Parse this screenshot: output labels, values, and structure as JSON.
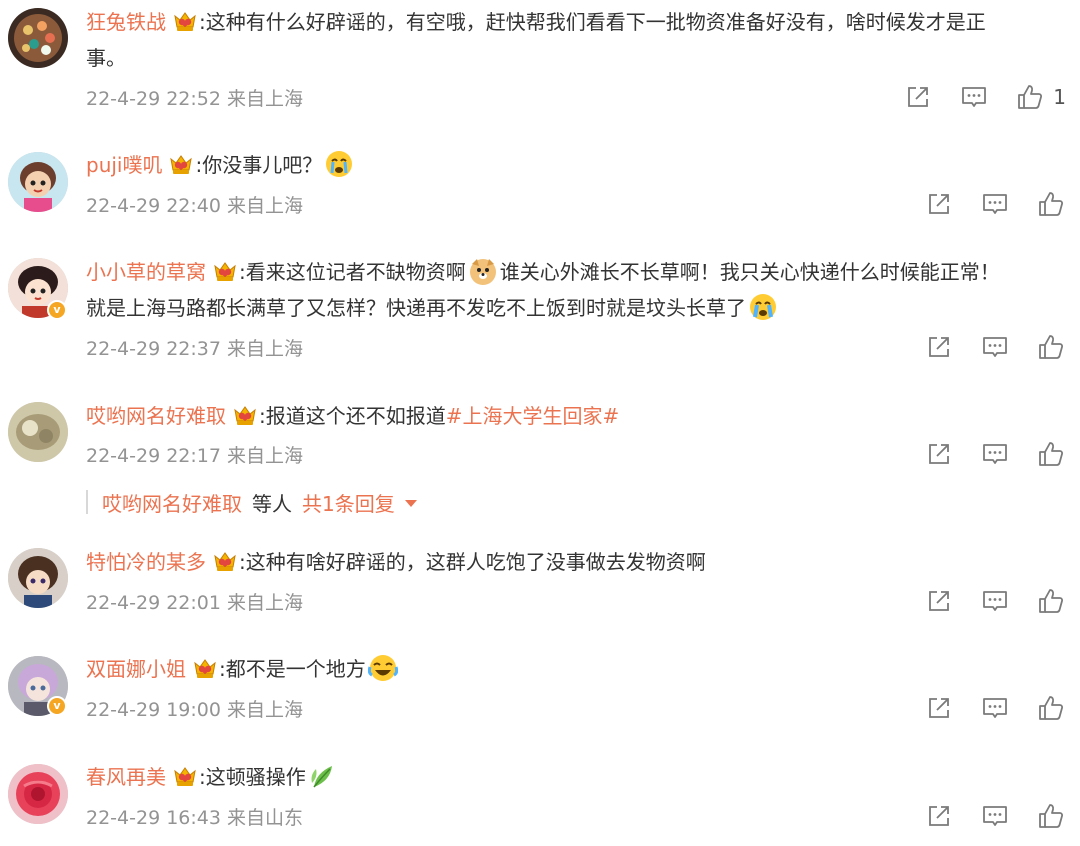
{
  "comments": [
    {
      "user": "狂兔铁战",
      "text": ":这种有什么好辟谣的，有空哦，赶快帮我们看看下一批物资准备好没有，啥时候发才是正",
      "text2": "事。",
      "time": "22-4-29 22:52",
      "location": "来自上海",
      "likes": "1"
    },
    {
      "user": "puji噗叽",
      "text": ":你没事儿吧？",
      "time": "22-4-29 22:40",
      "location": "来自上海"
    },
    {
      "user": "小小草的草窝",
      "text": ":看来这位记者不缺物资啊",
      "text_b": "谁关心外滩长不长草啊！我只关心快递什么时候能正常！",
      "text2": "就是上海马路都长满草了又怎样？快递再不发吃不上饭到时就是坟头长草了",
      "time": "22-4-29 22:37",
      "location": "来自上海"
    },
    {
      "user": "哎哟网名好难取",
      "text": ":报道这个还不如报道",
      "topic": "#上海大学生回家#",
      "time": "22-4-29 22:17",
      "location": "来自上海"
    },
    {
      "user": "特怕冷的某多",
      "text": ":这种有啥好辟谣的，这群人吃饱了没事做去发物资啊",
      "time": "22-4-29 22:01",
      "location": "来自上海"
    },
    {
      "user": "双面娜小姐",
      "text": ":都不是一个地方",
      "time": "22-4-29 19:00",
      "location": "来自上海"
    },
    {
      "user": "春风再美",
      "text": ":这顿骚操作",
      "time": "22-4-29 16:43",
      "location": "来自山东"
    }
  ],
  "reply_summary": {
    "user": "哎哟网名好难取",
    "middle": "等人",
    "count": "共1条回复"
  },
  "colors": {
    "username": "#eb7350",
    "meta": "#939393",
    "text": "#333333",
    "badge": "#f5a623"
  }
}
